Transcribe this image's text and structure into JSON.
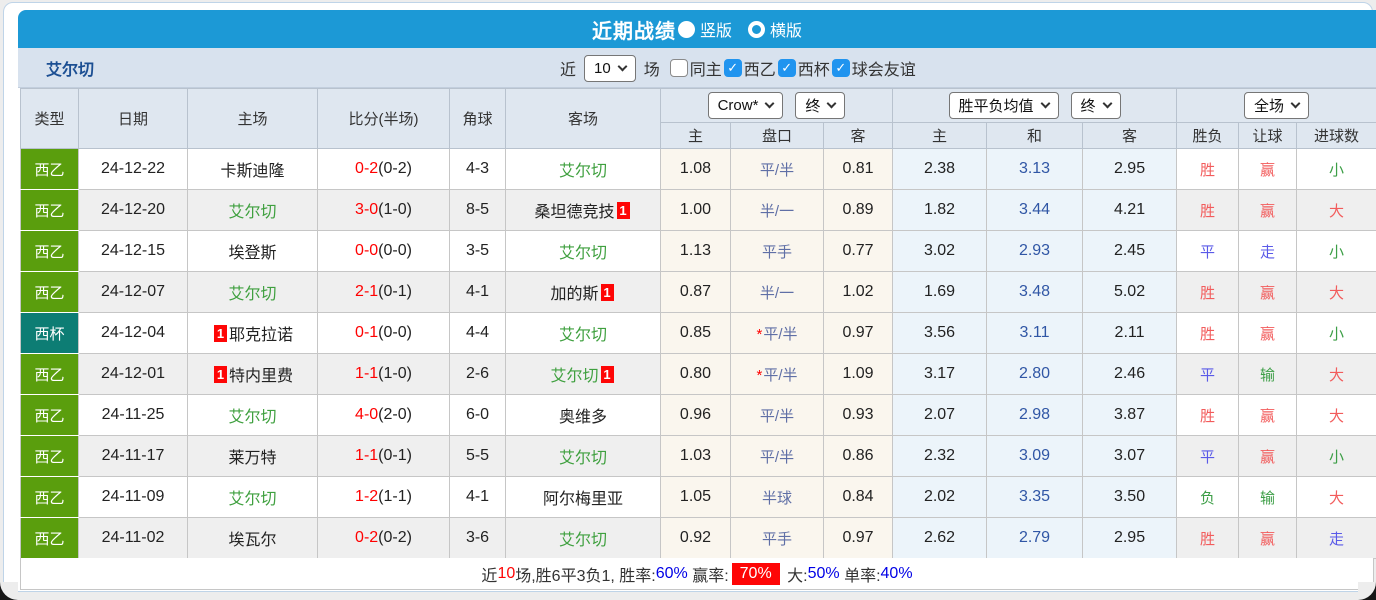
{
  "header": {
    "title": "近期战绩",
    "radios": [
      {
        "label": "竖版",
        "selected": true
      },
      {
        "label": "横版",
        "selected": false
      }
    ]
  },
  "filter": {
    "team": "艾尔切",
    "near_label": "近",
    "games_value": "10",
    "games_suffix": "场",
    "checkboxes": [
      {
        "label": "同主",
        "checked": false
      },
      {
        "label": "西乙",
        "checked": true
      },
      {
        "label": "西杯",
        "checked": true
      },
      {
        "label": "球会友谊",
        "checked": true
      }
    ]
  },
  "table": {
    "static_headers": [
      "类型",
      "日期",
      "主场",
      "比分(半场)",
      "角球",
      "客场"
    ],
    "group1_select": "Crow*",
    "group1_period": "终",
    "group2_select": "胜平负均值",
    "group2_period": "终",
    "group3_select": "全场",
    "sub_headers": [
      "主",
      "盘口",
      "客",
      "主",
      "和",
      "客",
      "胜负",
      "让球",
      "进球数"
    ],
    "rows": [
      {
        "type": "西乙",
        "category": "league",
        "date": "24-12-22",
        "home": "卡斯迪隆",
        "home_focus": false,
        "home_badge": null,
        "score_ft": "0-2",
        "score_ht": "(0-2)",
        "corners": "4-3",
        "away": "艾尔切",
        "away_focus": true,
        "away_badge": null,
        "crow_home": "1.08",
        "handicap": "平/半",
        "handicap_star": false,
        "crow_away": "0.81",
        "avg_home": "2.38",
        "avg_draw": "3.13",
        "avg_away": "2.95",
        "result": {
          "t": "胜",
          "c": "r"
        },
        "let_result": {
          "t": "赢",
          "c": "r"
        },
        "goal_result": {
          "t": "小",
          "c": "g"
        }
      },
      {
        "type": "西乙",
        "category": "league",
        "date": "24-12-20",
        "home": "艾尔切",
        "home_focus": true,
        "home_badge": null,
        "score_ft": "3-0",
        "score_ht": "(1-0)",
        "corners": "8-5",
        "away": "桑坦德竞技",
        "away_focus": false,
        "away_badge": "1",
        "crow_home": "1.00",
        "handicap": "半/一",
        "handicap_star": false,
        "crow_away": "0.89",
        "avg_home": "1.82",
        "avg_draw": "3.44",
        "avg_away": "4.21",
        "result": {
          "t": "胜",
          "c": "r"
        },
        "let_result": {
          "t": "赢",
          "c": "r"
        },
        "goal_result": {
          "t": "大",
          "c": "r"
        }
      },
      {
        "type": "西乙",
        "category": "league",
        "date": "24-12-15",
        "home": "埃登斯",
        "home_focus": false,
        "home_badge": null,
        "score_ft": "0-0",
        "score_ht": "(0-0)",
        "corners": "3-5",
        "away": "艾尔切",
        "away_focus": true,
        "away_badge": null,
        "crow_home": "1.13",
        "handicap": "平手",
        "handicap_star": false,
        "crow_away": "0.77",
        "avg_home": "3.02",
        "avg_draw": "2.93",
        "avg_away": "2.45",
        "result": {
          "t": "平",
          "c": "b"
        },
        "let_result": {
          "t": "走",
          "c": "b"
        },
        "goal_result": {
          "t": "小",
          "c": "g"
        }
      },
      {
        "type": "西乙",
        "category": "league",
        "date": "24-12-07",
        "home": "艾尔切",
        "home_focus": true,
        "home_badge": null,
        "score_ft": "2-1",
        "score_ht": "(0-1)",
        "corners": "4-1",
        "away": "加的斯",
        "away_focus": false,
        "away_badge": "1",
        "crow_home": "0.87",
        "handicap": "半/一",
        "handicap_star": false,
        "crow_away": "1.02",
        "avg_home": "1.69",
        "avg_draw": "3.48",
        "avg_away": "5.02",
        "result": {
          "t": "胜",
          "c": "r"
        },
        "let_result": {
          "t": "赢",
          "c": "r"
        },
        "goal_result": {
          "t": "大",
          "c": "r"
        }
      },
      {
        "type": "西杯",
        "category": "cup",
        "date": "24-12-04",
        "home": "耶克拉诺",
        "home_focus": false,
        "home_badge": "1",
        "score_ft": "0-1",
        "score_ht": "(0-0)",
        "corners": "4-4",
        "away": "艾尔切",
        "away_focus": true,
        "away_badge": null,
        "crow_home": "0.85",
        "handicap": "平/半",
        "handicap_star": true,
        "crow_away": "0.97",
        "avg_home": "3.56",
        "avg_draw": "3.11",
        "avg_away": "2.11",
        "result": {
          "t": "胜",
          "c": "r"
        },
        "let_result": {
          "t": "赢",
          "c": "r"
        },
        "goal_result": {
          "t": "小",
          "c": "g"
        }
      },
      {
        "type": "西乙",
        "category": "league",
        "date": "24-12-01",
        "home": "特内里费",
        "home_focus": false,
        "home_badge": "1",
        "score_ft": "1-1",
        "score_ht": "(1-0)",
        "corners": "2-6",
        "away": "艾尔切",
        "away_focus": true,
        "away_badge": "1",
        "crow_home": "0.80",
        "handicap": "平/半",
        "handicap_star": true,
        "crow_away": "1.09",
        "avg_home": "3.17",
        "avg_draw": "2.80",
        "avg_away": "2.46",
        "result": {
          "t": "平",
          "c": "b"
        },
        "let_result": {
          "t": "输",
          "c": "g"
        },
        "goal_result": {
          "t": "大",
          "c": "r"
        }
      },
      {
        "type": "西乙",
        "category": "league",
        "date": "24-11-25",
        "home": "艾尔切",
        "home_focus": true,
        "home_badge": null,
        "score_ft": "4-0",
        "score_ht": "(2-0)",
        "corners": "6-0",
        "away": "奥维多",
        "away_focus": false,
        "away_badge": null,
        "crow_home": "0.96",
        "handicap": "平/半",
        "handicap_star": false,
        "crow_away": "0.93",
        "avg_home": "2.07",
        "avg_draw": "2.98",
        "avg_away": "3.87",
        "result": {
          "t": "胜",
          "c": "r"
        },
        "let_result": {
          "t": "赢",
          "c": "r"
        },
        "goal_result": {
          "t": "大",
          "c": "r"
        }
      },
      {
        "type": "西乙",
        "category": "league",
        "date": "24-11-17",
        "home": "莱万特",
        "home_focus": false,
        "home_badge": null,
        "score_ft": "1-1",
        "score_ht": "(0-1)",
        "corners": "5-5",
        "away": "艾尔切",
        "away_focus": true,
        "away_badge": null,
        "crow_home": "1.03",
        "handicap": "平/半",
        "handicap_star": false,
        "crow_away": "0.86",
        "avg_home": "2.32",
        "avg_draw": "3.09",
        "avg_away": "3.07",
        "result": {
          "t": "平",
          "c": "b"
        },
        "let_result": {
          "t": "赢",
          "c": "r"
        },
        "goal_result": {
          "t": "小",
          "c": "g"
        }
      },
      {
        "type": "西乙",
        "category": "league",
        "date": "24-11-09",
        "home": "艾尔切",
        "home_focus": true,
        "home_badge": null,
        "score_ft": "1-2",
        "score_ht": "(1-1)",
        "corners": "4-1",
        "away": "阿尔梅里亚",
        "away_focus": false,
        "away_badge": null,
        "crow_home": "1.05",
        "handicap": "半球",
        "handicap_star": false,
        "crow_away": "0.84",
        "avg_home": "2.02",
        "avg_draw": "3.35",
        "avg_away": "3.50",
        "result": {
          "t": "负",
          "c": "g"
        },
        "let_result": {
          "t": "输",
          "c": "g"
        },
        "goal_result": {
          "t": "大",
          "c": "r"
        }
      },
      {
        "type": "西乙",
        "category": "league",
        "date": "24-11-02",
        "home": "埃瓦尔",
        "home_focus": false,
        "home_badge": null,
        "score_ft": "0-2",
        "score_ht": "(0-2)",
        "corners": "3-6",
        "away": "艾尔切",
        "away_focus": true,
        "away_badge": null,
        "crow_home": "0.92",
        "handicap": "平手",
        "handicap_star": false,
        "crow_away": "0.97",
        "avg_home": "2.62",
        "avg_draw": "2.79",
        "avg_away": "2.95",
        "result": {
          "t": "胜",
          "c": "r"
        },
        "let_result": {
          "t": "赢",
          "c": "r"
        },
        "goal_result": {
          "t": "走",
          "c": "b"
        }
      }
    ]
  },
  "footer": {
    "t1": "近",
    "t2": "10",
    "t3": "场,胜6平3负1, 胜率:",
    "t4": "60%",
    "t5": " 赢率:",
    "t6": "70%",
    "t7": " 大:",
    "t8": "50%",
    "t9": " 单率:",
    "t10": "40%"
  }
}
